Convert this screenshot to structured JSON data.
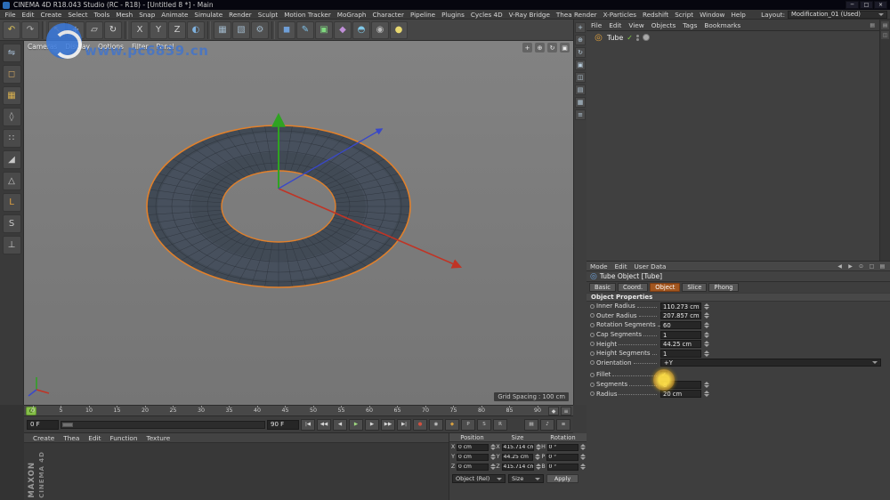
{
  "titlebar": {
    "title": "CINEMA 4D R18.043 Studio (RC - R18) - [Untitled 8 *] - Main",
    "window_buttons": [
      {
        "name": "minimize-button",
        "glyph": "─"
      },
      {
        "name": "restore-button",
        "glyph": "□"
      },
      {
        "name": "close-button",
        "glyph": "×"
      }
    ]
  },
  "menubar": {
    "items": [
      "File",
      "Edit",
      "Create",
      "Select",
      "Tools",
      "Mesh",
      "Snap",
      "Animate",
      "Simulate",
      "Render",
      "Sculpt",
      "Motion Tracker",
      "MoGraph",
      "Character",
      "Pipeline",
      "Plugins",
      "Cycles 4D",
      "V-Ray Bridge",
      "Thea Render",
      "X-Particles",
      "Redshift",
      "Script",
      "Window",
      "Help"
    ],
    "layout_label": "Layout:",
    "layout_value": "Modification_01 (Used)"
  },
  "toolbar": {
    "icons": [
      {
        "name": "undo-icon",
        "glyph": "↶",
        "color": "#d9c05a"
      },
      {
        "name": "redo-icon",
        "glyph": "↷",
        "color": "#b0b0b0"
      },
      {
        "type": "sep"
      },
      {
        "name": "live-selection-icon",
        "glyph": "↖",
        "color": "#e8a03a"
      },
      {
        "name": "move-tool-icon",
        "glyph": "+",
        "color": "#e0e0e0"
      },
      {
        "name": "scale-tool-icon",
        "glyph": "▱",
        "color": "#d8d8d8"
      },
      {
        "name": "rotate-tool-icon",
        "glyph": "↻",
        "color": "#d8d8d8"
      },
      {
        "type": "sep"
      },
      {
        "name": "lock-x-axis-icon",
        "glyph": "X",
        "color": "#cccccc"
      },
      {
        "name": "lock-y-axis-icon",
        "glyph": "Y",
        "color": "#cccccc"
      },
      {
        "name": "lock-z-axis-icon",
        "glyph": "Z",
        "color": "#cccccc"
      },
      {
        "name": "coord-system-icon",
        "glyph": "◐",
        "color": "#7fb2e0"
      },
      {
        "type": "sep"
      },
      {
        "name": "render-view-icon",
        "glyph": "▦",
        "color": "#9fb6c8"
      },
      {
        "name": "render-picture-viewer-icon",
        "glyph": "▧",
        "color": "#9fb6c8"
      },
      {
        "name": "render-settings-icon",
        "glyph": "⚙",
        "color": "#9fb6c8"
      },
      {
        "type": "sep"
      },
      {
        "name": "add-primitive-cube-icon",
        "glyph": "◼",
        "color": "#6f9fd8"
      },
      {
        "name": "add-spline-pen-icon",
        "glyph": "✎",
        "color": "#7fc0e8"
      },
      {
        "name": "add-generator-icon",
        "glyph": "▣",
        "color": "#7fd87f"
      },
      {
        "name": "add-deformer-icon",
        "glyph": "◆",
        "color": "#c08fd8"
      },
      {
        "name": "add-environment-icon",
        "glyph": "◓",
        "color": "#80c8e8"
      },
      {
        "name": "add-camera-icon",
        "glyph": "◉",
        "color": "#b8b8b8"
      },
      {
        "name": "add-light-icon",
        "glyph": "●",
        "color": "#e8d870"
      }
    ]
  },
  "left_palette": {
    "icons": [
      {
        "name": "make-editable-icon",
        "glyph": "⇋",
        "color": "#a8c0d8"
      },
      {
        "name": "model-mode-icon",
        "glyph": "◻",
        "color": "#c8a060"
      },
      {
        "name": "texture-mode-icon",
        "glyph": "▦",
        "color": "#d8b050"
      },
      {
        "name": "workplane-mode-icon",
        "glyph": "◊",
        "color": "#b0b0b0"
      },
      {
        "name": "points-mode-icon",
        "glyph": "∷",
        "color": "#c8c8c8"
      },
      {
        "name": "edges-mode-icon",
        "glyph": "◢",
        "color": "#c8c8c8"
      },
      {
        "name": "polygons-mode-icon",
        "glyph": "△",
        "color": "#c8c8c8"
      },
      {
        "name": "enable-axis-icon",
        "glyph": "L",
        "color": "#e0a040"
      },
      {
        "name": "snap-icon",
        "glyph": "S",
        "color": "#c8c8c8"
      },
      {
        "name": "workplane-lock-icon",
        "glyph": "⊥",
        "color": "#c8c8c8"
      }
    ]
  },
  "viewport": {
    "menu": [
      "Cameras",
      "Display",
      "Options",
      "Filter",
      "Panel"
    ],
    "nav_icons": [
      {
        "name": "pan-view-icon",
        "glyph": "+"
      },
      {
        "name": "zoom-view-icon",
        "glyph": "⊕"
      },
      {
        "name": "rotate-view-icon",
        "glyph": "↻"
      },
      {
        "name": "toggle-view-icon",
        "glyph": "▣"
      }
    ],
    "grid_spacing": "Grid Spacing : 100 cm",
    "watermark_text": "www.pc6839.cn"
  },
  "side_strip": {
    "icons": [
      {
        "name": "view-move-icon",
        "glyph": "+"
      },
      {
        "name": "view-zoom-icon",
        "glyph": "⊕"
      },
      {
        "name": "view-rotate-icon",
        "glyph": "↻"
      },
      {
        "name": "view-maximize-icon",
        "glyph": "▣"
      },
      {
        "name": "view-layout-icon",
        "glyph": "◫"
      },
      {
        "name": "view-cells-icon",
        "glyph": "▤"
      },
      {
        "name": "view-grid-icon",
        "glyph": "▦"
      },
      {
        "name": "view-options-icon",
        "glyph": "≡"
      }
    ]
  },
  "objects_panel": {
    "menu": [
      "File",
      "Edit",
      "View",
      "Objects",
      "Tags",
      "Bookmarks"
    ],
    "panel_menu_icon": "▤",
    "items": [
      {
        "label": "Tube"
      }
    ]
  },
  "attributes": {
    "menu": [
      "Mode",
      "Edit",
      "User Data"
    ],
    "header_icons": [
      {
        "name": "attr-back-icon",
        "glyph": "◀"
      },
      {
        "name": "attr-forward-icon",
        "glyph": "▶"
      },
      {
        "name": "attr-search-icon",
        "glyph": "⊙"
      },
      {
        "name": "attr-lock-icon",
        "glyph": "□"
      },
      {
        "name": "attr-menu-icon",
        "glyph": "▤"
      }
    ],
    "title": "Tube Object [Tube]",
    "tabs": [
      {
        "label": "Basic"
      },
      {
        "label": "Coord."
      },
      {
        "label": "Object",
        "active": true
      },
      {
        "label": "Slice"
      },
      {
        "label": "Phong"
      }
    ],
    "section": "Object Properties",
    "rows": [
      {
        "label": "Inner Radius",
        "value": "110.273 cm",
        "type": "spinner"
      },
      {
        "label": "Outer Radius",
        "value": "207.857 cm",
        "type": "spinner"
      },
      {
        "label": "Rotation Segments",
        "value": "60",
        "type": "spinner"
      },
      {
        "label": "Cap Segments",
        "value": "1",
        "type": "spinner"
      },
      {
        "label": "Height",
        "value": "44.25 cm",
        "type": "spinner"
      },
      {
        "label": "Height Segments",
        "value": "1",
        "type": "spinner"
      },
      {
        "label": "Orientation",
        "value": "+Y",
        "type": "dropdown"
      },
      {
        "label": "Fillet",
        "value": "✓",
        "type": "checkbox"
      },
      {
        "label": "Segments",
        "value": "8",
        "type": "spinner"
      },
      {
        "label": "Radius",
        "value": "20 cm",
        "type": "spinner"
      }
    ]
  },
  "timeline": {
    "ticks": [
      "0",
      "5",
      "10",
      "15",
      "20",
      "25",
      "30",
      "35",
      "40",
      "45",
      "50",
      "55",
      "60",
      "65",
      "70",
      "75",
      "80",
      "85",
      "90"
    ],
    "playhead": "0",
    "ruler_buttons": [
      {
        "name": "timeline-key-icon",
        "glyph": "◆"
      },
      {
        "name": "timeline-menu-icon",
        "glyph": "≡"
      }
    ]
  },
  "transport": {
    "current_frame": "0 F",
    "end_frame": "90 F",
    "nav_buttons": [
      {
        "name": "goto-start-button",
        "glyph": "|◀"
      },
      {
        "name": "prev-key-button",
        "glyph": "◀◀"
      },
      {
        "name": "prev-frame-button",
        "glyph": "◀"
      },
      {
        "name": "play-button",
        "glyph": "▶",
        "color": "#9fd87f"
      },
      {
        "name": "next-frame-button",
        "glyph": "▶"
      },
      {
        "name": "next-key-button",
        "glyph": "▶▶"
      },
      {
        "name": "goto-end-button",
        "glyph": "▶|"
      }
    ],
    "record_buttons": [
      {
        "name": "record-keyframe-button",
        "glyph": "●",
        "color": "#d05040"
      },
      {
        "name": "autokey-button",
        "glyph": "◉",
        "color": "#c8c8c8"
      },
      {
        "name": "keyframe-selection-button",
        "glyph": "◆",
        "color": "#d8a040"
      },
      {
        "name": "record-position-button",
        "glyph": "P",
        "color": "#c8c8c8"
      },
      {
        "name": "record-scale-button",
        "glyph": "S",
        "color": "#c8c8c8"
      },
      {
        "name": "record-rotation-button",
        "glyph": "R",
        "color": "#c8c8c8"
      }
    ],
    "right_buttons": [
      {
        "name": "playback-mode-button",
        "glyph": "▤"
      },
      {
        "name": "sound-toggle-button",
        "glyph": "♪"
      },
      {
        "name": "transport-options-button",
        "glyph": "≡"
      }
    ]
  },
  "materials": {
    "menu": [
      "Create",
      "Thea",
      "Edit",
      "Function",
      "Texture"
    ]
  },
  "coordinates": {
    "columns": [
      {
        "header": "Position",
        "rows": [
          {
            "axis": "X",
            "value": "0 cm"
          },
          {
            "axis": "Y",
            "value": "0 cm"
          },
          {
            "axis": "Z",
            "value": "0 cm"
          }
        ]
      },
      {
        "header": "Size",
        "rows": [
          {
            "axis": "X",
            "value": "415.714 cm"
          },
          {
            "axis": "Y",
            "value": "44.25 cm"
          },
          {
            "axis": "Z",
            "value": "415.714 cm"
          }
        ]
      },
      {
        "header": "Rotation",
        "rows": [
          {
            "axis": "H",
            "value": "0 °"
          },
          {
            "axis": "P",
            "value": "0 °"
          },
          {
            "axis": "B",
            "value": "0 °"
          }
        ]
      }
    ],
    "mode_dropdown": "Object (Rel)",
    "size_dropdown": "Size",
    "apply_label": "Apply"
  },
  "branding": {
    "line1": "MAXON",
    "line2": "CINEMA 4D"
  },
  "edge_strip": {
    "icons": [
      {
        "name": "dock-tab-icon",
        "glyph": "▤"
      },
      {
        "name": "dock-tab-alt-icon",
        "glyph": "◫"
      }
    ]
  },
  "colors": {
    "accent_orange": "#e2802a",
    "axis_green": "#2fa321",
    "axis_red": "#c03425",
    "axis_blue": "#3948c9",
    "playhead_green": "#86bf4a",
    "active_tab": "#a2561f"
  }
}
